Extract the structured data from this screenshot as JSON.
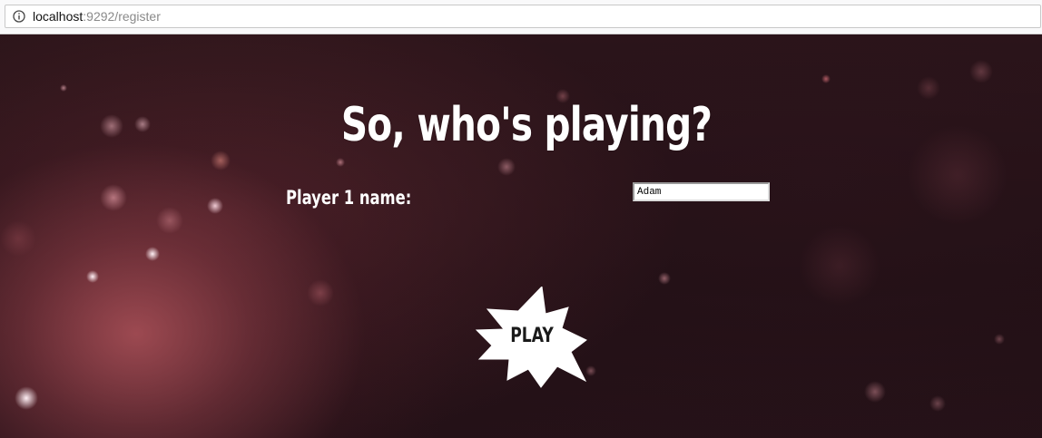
{
  "browser": {
    "url_host": "localhost",
    "url_rest": ":9292/register"
  },
  "page": {
    "title": "So, who's playing?",
    "player1_label": "Player 1 name:",
    "player1_value": "Adam",
    "play_label": "PLAY"
  },
  "colors": {
    "title": "#ffffff",
    "background_dark": "#1f0f14",
    "accent_glow": "#af525a",
    "button_fill": "#ffffff"
  }
}
